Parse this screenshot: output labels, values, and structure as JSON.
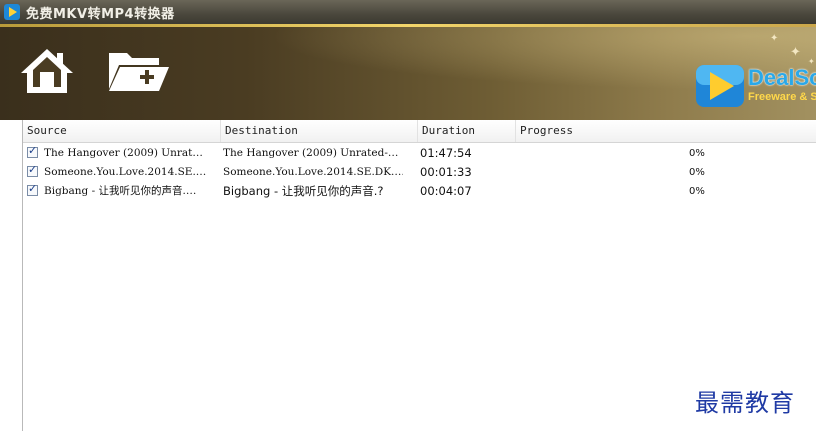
{
  "window": {
    "title": "免费MKV转MP4转换器"
  },
  "toolbar": {
    "home_icon": "home-icon",
    "add_folder_icon": "add-folder-icon"
  },
  "brand": {
    "name": "DealSc",
    "tagline": "Freeware & S"
  },
  "table": {
    "columns": [
      "Source",
      "Destination",
      "Duration",
      "Progress"
    ],
    "rows": [
      {
        "checked": true,
        "source": "The Hangover (2009) Unrat…",
        "destination": "The Hangover (2009) Unrated-…",
        "duration": "01:47:54",
        "progress": "0%"
      },
      {
        "checked": true,
        "source": "Someone.You.Love.2014.SE.…",
        "destination": "Someone.You.Love.2014.SE.DK.…",
        "duration": "00:01:33",
        "progress": "0%"
      },
      {
        "checked": true,
        "source": "Bigbang - 让我听见你的声音.…",
        "destination": "Bigbang - 让我听见你的声音.?",
        "duration": "00:04:07",
        "progress": "0%"
      }
    ]
  },
  "watermark": "最需教育",
  "colors": {
    "brand_blue": "#2aa8e8",
    "tagline_yellow": "#ffd84a",
    "gold_accent": "#f2d56b",
    "watermark_blue": "#1f3aa4"
  }
}
